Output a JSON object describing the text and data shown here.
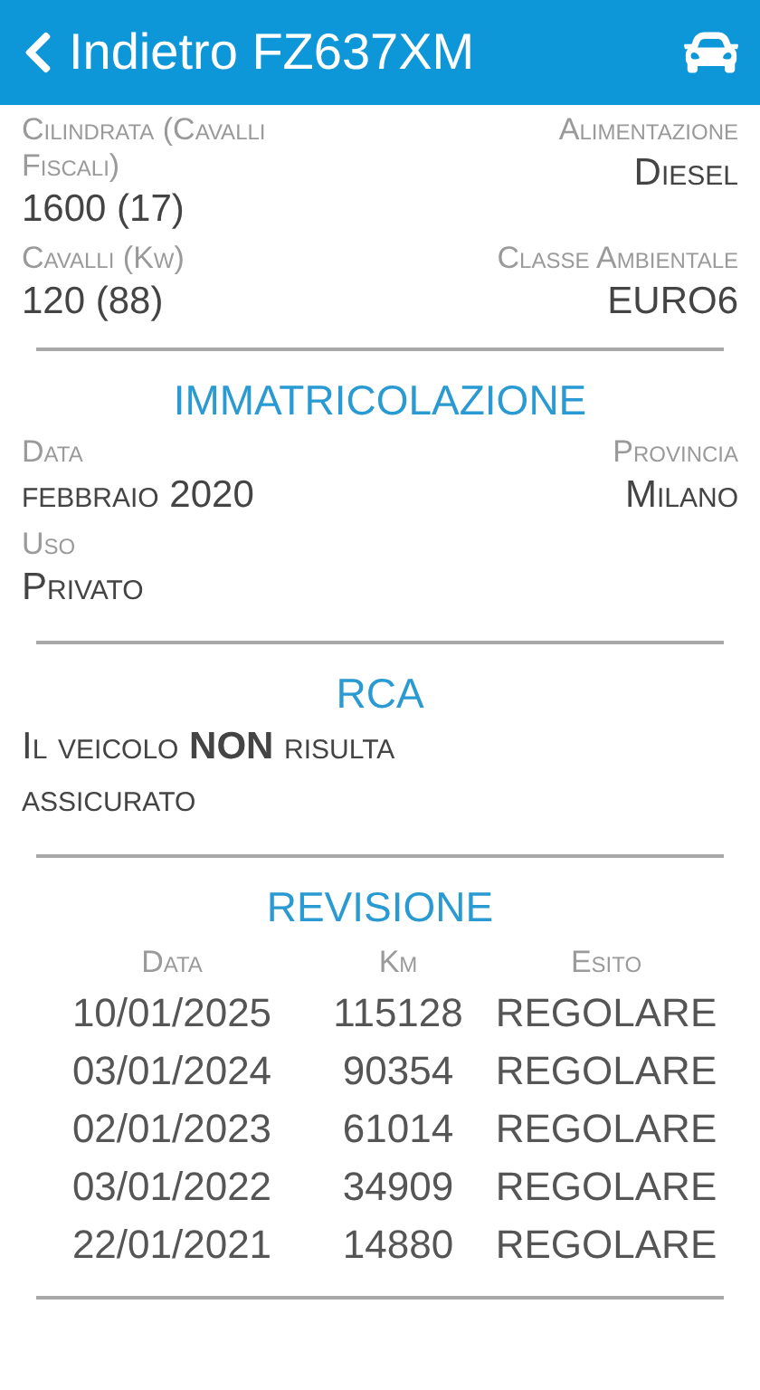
{
  "header": {
    "back_label": "Indietro",
    "title": "FZ637XM"
  },
  "vehicle_fields": [
    {
      "label": "Cilindrata (Cavalli Fiscali)",
      "value": "1600 (17)"
    },
    {
      "label": "Alimentazione",
      "value": "Diesel"
    },
    {
      "label": "Cavalli (Kw)",
      "value": "120 (88)"
    },
    {
      "label": "Classe Ambientale",
      "value": "EURO6"
    }
  ],
  "registration": {
    "title": "IMMATRICOLAZIONE",
    "fields": [
      {
        "label": "Data",
        "value": "febbraio 2020"
      },
      {
        "label": "Provincia",
        "value": "Milano"
      },
      {
        "label": "Uso",
        "value": "Privato"
      }
    ]
  },
  "insurance": {
    "title": "RCA",
    "message": "Il veicolo **NON** risulta assicurato"
  },
  "inspection": {
    "title": "REVISIONE",
    "columns": [
      "Data",
      "Km",
      "Esito"
    ],
    "rows": [
      [
        "10/01/2025",
        "115128",
        "REGOLARE"
      ],
      [
        "03/01/2024",
        "90354",
        "REGOLARE"
      ],
      [
        "02/01/2023",
        "61014",
        "REGOLARE"
      ],
      [
        "03/01/2022",
        "34909",
        "REGOLARE"
      ],
      [
        "22/01/2021",
        "14880",
        "REGOLARE"
      ]
    ]
  }
}
